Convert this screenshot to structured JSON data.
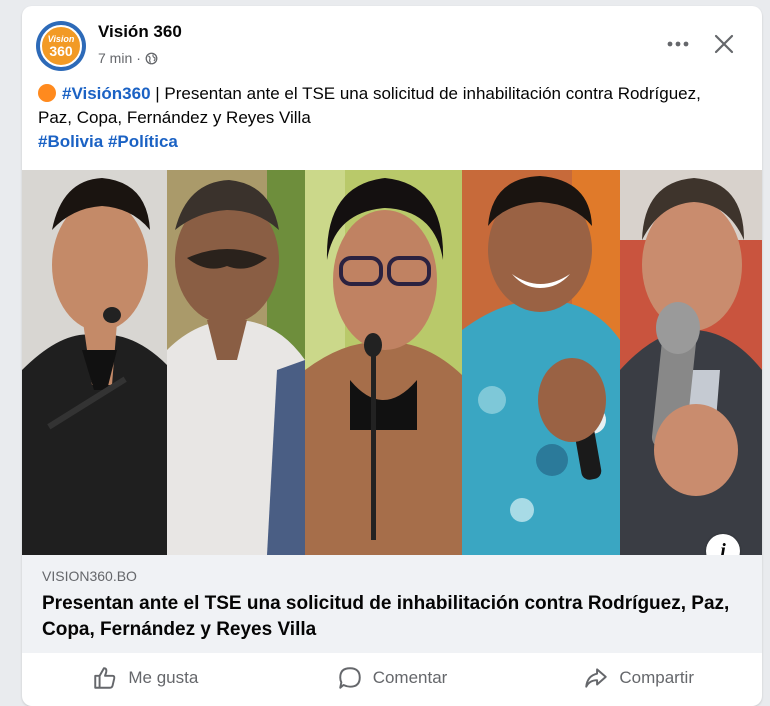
{
  "post": {
    "page_name": "Visión 360",
    "avatar_top": "Vision",
    "avatar_num": "360",
    "time": "7 min",
    "separator": "·",
    "hashtag_page": "#Visión360",
    "text_main": " | Presentan ante el TSE una solicitud de inhabilitación contra Rodríguez, Paz, Copa, Fernández y Reyes Villa",
    "tag_bolivia": "#Bolivia",
    "tag_politica": "#Política"
  },
  "link": {
    "domain": "VISION360.BO",
    "title": "Presentan ante el TSE una solicitud de inhabilitación contra Rodríguez, Paz, Copa, Fernández y Reyes Villa",
    "info": "i"
  },
  "actions": {
    "like": "Me gusta",
    "comment": "Comentar",
    "share": "Compartir"
  },
  "colors": {
    "hashtag": "#1b62c4",
    "accent_orange": "#ff8a1e"
  }
}
